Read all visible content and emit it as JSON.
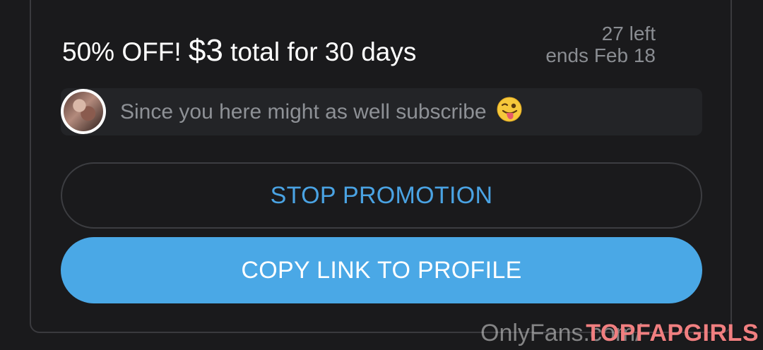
{
  "promo": {
    "headline_prefix": "50% OFF! ",
    "price": "$3",
    "headline_suffix": " total for 30 days",
    "remaining": "27 left",
    "ends": "ends Feb 18"
  },
  "message": {
    "text": "Since you here might as well subscribe"
  },
  "buttons": {
    "stop": "STOP PROMOTION",
    "copy": "COPY LINK TO PROFILE"
  },
  "watermarks": {
    "site": "OnlyFans.com/",
    "brand": "TOPFAPGIRLS"
  },
  "colors": {
    "background": "#1a1a1c",
    "accent": "#4aa8e6",
    "muted_text": "#8a8d92",
    "brand_watermark": "#f07f80"
  }
}
